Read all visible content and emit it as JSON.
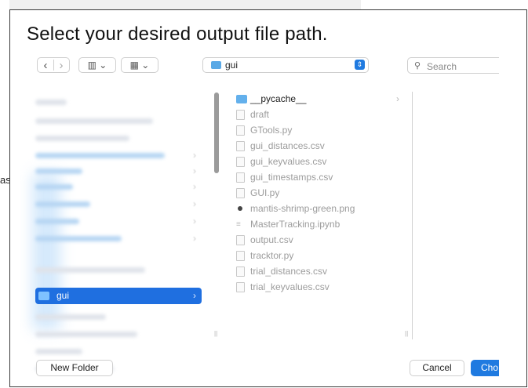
{
  "background": {
    "clipped_text": "as"
  },
  "dialog": {
    "prompt_title": "Select your desired output file path."
  },
  "toolbar": {
    "back_glyph": "‹",
    "forward_glyph": "›",
    "view_columns_glyph": "▥ ⌄",
    "view_grid_glyph": "▦ ⌄"
  },
  "path_selector": {
    "current_folder": "gui",
    "stepper_glyph": "⇕"
  },
  "search": {
    "placeholder": "Search"
  },
  "sidebar": {
    "selected_item": "gui",
    "selected_chevron": "›"
  },
  "file_list": {
    "items": [
      {
        "name": "__pycache__",
        "kind": "folder",
        "has_children": true,
        "chevron": "›"
      },
      {
        "name": "draft",
        "kind": "file"
      },
      {
        "name": "GTools.py",
        "kind": "file"
      },
      {
        "name": "gui_distances.csv",
        "kind": "file"
      },
      {
        "name": "gui_keyvalues.csv",
        "kind": "file"
      },
      {
        "name": "gui_timestamps.csv",
        "kind": "file"
      },
      {
        "name": "GUI.py",
        "kind": "file"
      },
      {
        "name": "mantis-shrimp-green.png",
        "kind": "image"
      },
      {
        "name": "MasterTracking.ipynb",
        "kind": "notebook"
      },
      {
        "name": "output.csv",
        "kind": "file"
      },
      {
        "name": "tracktor.py",
        "kind": "file"
      },
      {
        "name": "trial_distances.csv",
        "kind": "file"
      },
      {
        "name": "trial_keyvalues.csv",
        "kind": "file"
      }
    ]
  },
  "buttons": {
    "new_folder": "New Folder",
    "cancel": "Cancel",
    "choose": "Cho"
  },
  "colors": {
    "accent": "#1f7ae0",
    "selection": "#1f6fe0",
    "folder": "#63b0ec"
  }
}
